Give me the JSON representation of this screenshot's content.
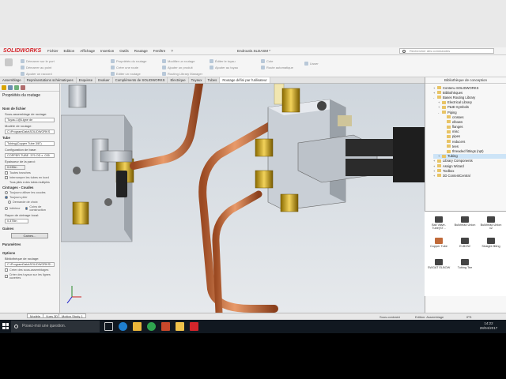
{
  "app": {
    "logo_text": "SOLIDWORKS",
    "document_title": "Endroutin.SLDASM *",
    "search_placeholder": "Rechercher des commandes"
  },
  "menu": [
    "Fichier",
    "Edition",
    "Affichage",
    "Insertion",
    "Outils",
    "Routage",
    "Fenêtre",
    "?"
  ],
  "ribbon": {
    "buttons": [
      "Démarrer sur le port",
      "Démarrer au point",
      "Ajouter un raccord",
      "Propriétés du routage",
      "Créer une route",
      "Editer un routage",
      "Modifier un routage",
      "Ajouter un produit",
      "Routing Library Manager",
      "Éditer le tuyau",
      "Ajouter au tuyau",
      "Cote",
      "Route automatique",
      "Lisser"
    ]
  },
  "tabs": [
    {
      "label": "Assemblage",
      "active": false
    },
    {
      "label": "Représentations schématiques",
      "active": false
    },
    {
      "label": "Esquisse",
      "active": false
    },
    {
      "label": "Evaluer",
      "active": false
    },
    {
      "label": "Compléments de SOLIDWORKS",
      "active": false
    },
    {
      "label": "Electrique",
      "active": false
    },
    {
      "label": "Tuyaux",
      "active": false
    },
    {
      "label": "Tubes",
      "active": false
    },
    {
      "label": "Routage défini par l'utilisateur",
      "active": true
    }
  ],
  "left_panel": {
    "title": "Propriétés du routage",
    "sections": {
      "tube_file": "Nom de fichier",
      "sub_assembly_label": "Sous-assemblage de routage:",
      "sub_assembly_value": "Tuyau-1@Ligne de",
      "template_label": "Modèle de routage:",
      "template_value": "C:\\ProgramData\\SOLIDWORKS",
      "tube_label": "Tube",
      "tube_value": "Tubing(Copper Tube 3/8\")",
      "base_config_label": "Configuration de base:",
      "base_config_value": "COPPER TUBE .375 OD x .035",
      "thickness_label": "Épaisseur de la paroi:",
      "thickness_value": "0.035in",
      "check_all": "Toutes tranches",
      "check_internal": "Interrompre les tubes en bord",
      "check_multiple": "Tous pliés à des tubes multiples",
      "bending_title": "Cintrages - Coudes",
      "radio_not_use": "Toujours utiliser les coudes",
      "radio_always": "Toujours plier",
      "radio_generate": "Demande de choix",
      "radio_inner": "Intérieur",
      "radio_outer": "Coins de construction",
      "bend_radius_label": "Rayon de cintrage local:",
      "bend_radius_value": "0.375in",
      "covering_title": "Gaines",
      "covering_btn": "Gaines...",
      "params_title": "Paramètres",
      "options_title": "Options",
      "lib_label": "Bibliothèque de routage:",
      "lib_value": "C:\\ProgramData\\SOLIDWORKS\\...",
      "opt1": "Créer des sous-assemblages",
      "opt2": "Créer des tuyaux sur les lignes ouvertes"
    }
  },
  "right_panel": {
    "title": "Bibliothèque de conception",
    "tree": [
      {
        "label": "Contenu SOLIDWORKS",
        "depth": 0,
        "exp": "+"
      },
      {
        "label": "Bibliothèques",
        "depth": 0,
        "exp": "+"
      },
      {
        "label": "Bases Routing Library",
        "depth": 0,
        "exp": "-"
      },
      {
        "label": "Electrical Library",
        "depth": 1,
        "exp": "+"
      },
      {
        "label": "P&ID Symbols",
        "depth": 1,
        "exp": "+"
      },
      {
        "label": "Piping",
        "depth": 1,
        "exp": "-"
      },
      {
        "label": "crosses",
        "depth": 2,
        "exp": ""
      },
      {
        "label": "elbows",
        "depth": 2,
        "exp": ""
      },
      {
        "label": "flanges",
        "depth": 2,
        "exp": ""
      },
      {
        "label": "misc",
        "depth": 2,
        "exp": ""
      },
      {
        "label": "pipes",
        "depth": 2,
        "exp": ""
      },
      {
        "label": "reducers",
        "depth": 2,
        "exp": ""
      },
      {
        "label": "tees",
        "depth": 2,
        "exp": ""
      },
      {
        "label": "threaded fittings (npt)",
        "depth": 2,
        "exp": ""
      },
      {
        "label": "Tubing",
        "depth": 1,
        "exp": "+",
        "selected": true
      },
      {
        "label": "Library Components",
        "depth": 0,
        "exp": "+"
      },
      {
        "label": "Assign Wizard",
        "depth": 0,
        "exp": "+"
      },
      {
        "label": "Toolbox",
        "depth": 0,
        "exp": "+"
      },
      {
        "label": "3D ContentCentral",
        "depth": 0,
        "exp": "+"
      }
    ],
    "parts": [
      "Ball Valve-Tube(ST...",
      "Bulkhead Union",
      "Bulkhead Union x2",
      "Copper Tube",
      "ELBOW",
      "Straight fitting",
      "SWGAT ELBOW",
      "Tubing Tee"
    ]
  },
  "bottom_tabs": [
    "Modèle",
    "Vues 3D",
    "Motion Study 1"
  ],
  "status": {
    "left": "",
    "mid": "Sous-contraint",
    "mid2": "Edition: Assemblage",
    "units": "IPS"
  },
  "taskbar": {
    "search_placeholder": "Posez-moi une question.",
    "time": "14:22",
    "date": "28/04/2017"
  }
}
